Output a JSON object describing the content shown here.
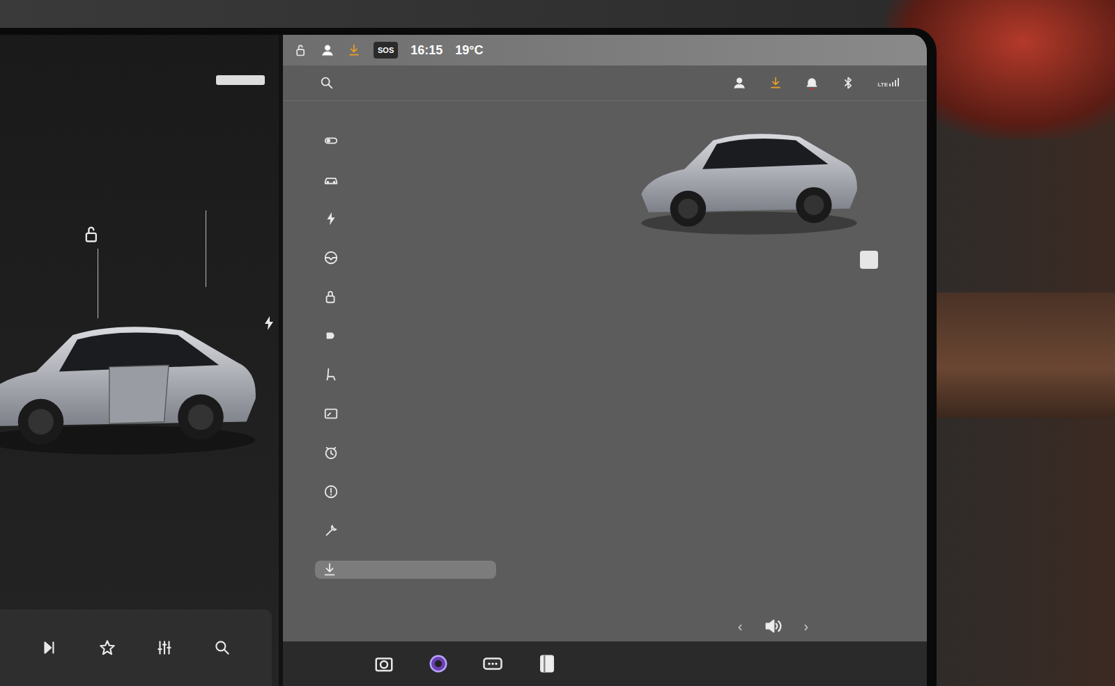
{
  "status_bar": {
    "sos": "SOS",
    "time": "16:15",
    "temperature": "19°C"
  },
  "header": {
    "network": "LTE",
    "notification": true
  },
  "car_panel": {
    "locked": false,
    "charging": true
  },
  "settings_menu": {
    "items": [
      {
        "kind": "controls",
        "selected": false
      },
      {
        "kind": "car",
        "selected": false
      },
      {
        "kind": "charging",
        "selected": false
      },
      {
        "kind": "autopilot",
        "selected": false
      },
      {
        "kind": "locks",
        "selected": false
      },
      {
        "kind": "lights",
        "selected": false
      },
      {
        "kind": "seat",
        "selected": false
      },
      {
        "kind": "display",
        "selected": false
      },
      {
        "kind": "schedule",
        "selected": false
      },
      {
        "kind": "safety",
        "selected": false
      },
      {
        "kind": "service",
        "selected": false
      },
      {
        "kind": "software",
        "selected": true
      }
    ]
  },
  "volume": {
    "prev": "‹",
    "next": "›"
  }
}
